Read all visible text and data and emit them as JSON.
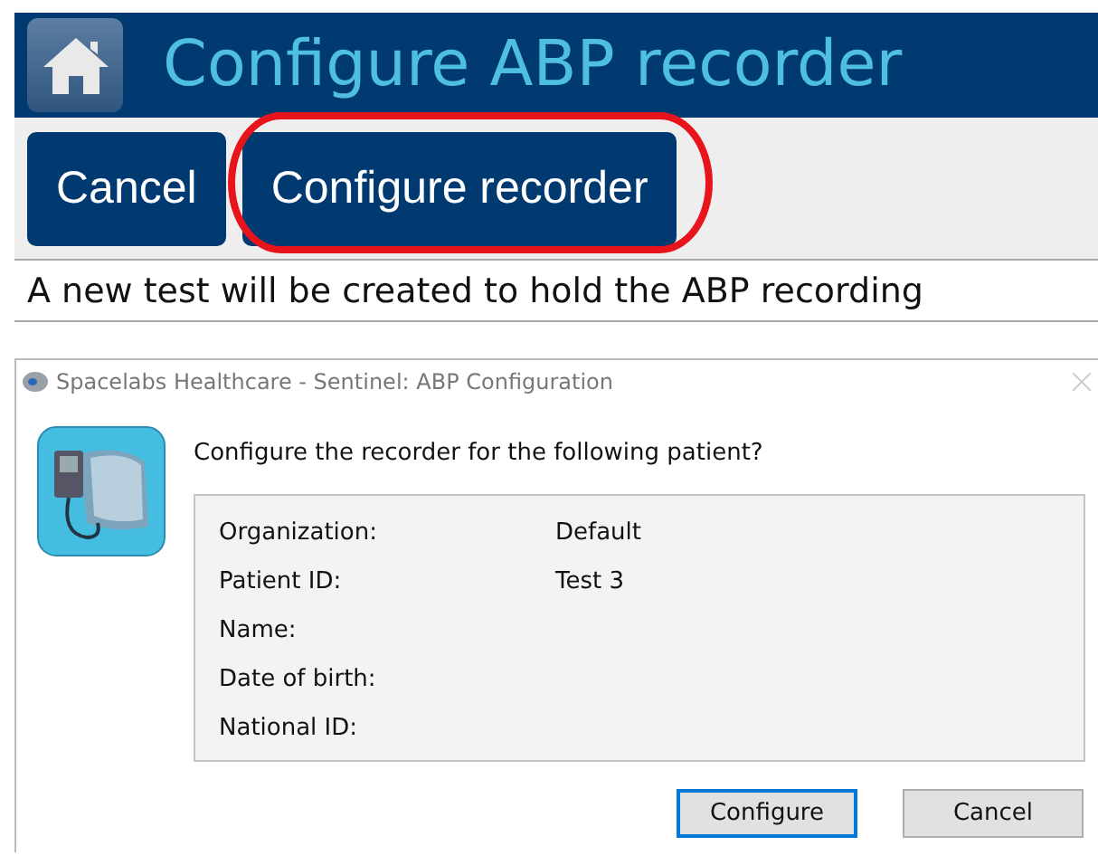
{
  "app": {
    "title": "Configure ABP recorder",
    "toolbar": [
      {
        "label": "Cancel",
        "highlighted": false
      },
      {
        "label": "Configure recorder",
        "highlighted": true
      }
    ],
    "message": "A new test will be created to hold the ABP recording"
  },
  "dialog": {
    "title": "Spacelabs Healthcare - Sentinel: ABP Configuration",
    "question": "Configure the recorder for the following patient?",
    "fields": [
      {
        "label": "Organization:",
        "value": "Default"
      },
      {
        "label": "Patient ID:",
        "value": "Test 3"
      },
      {
        "label": "Name:"
      },
      {
        "label": "Date of birth:"
      },
      {
        "label": "National ID:"
      }
    ],
    "buttons": [
      {
        "label": "Configure",
        "focused": true
      },
      {
        "label": "Cancel",
        "focused": false
      }
    ]
  }
}
